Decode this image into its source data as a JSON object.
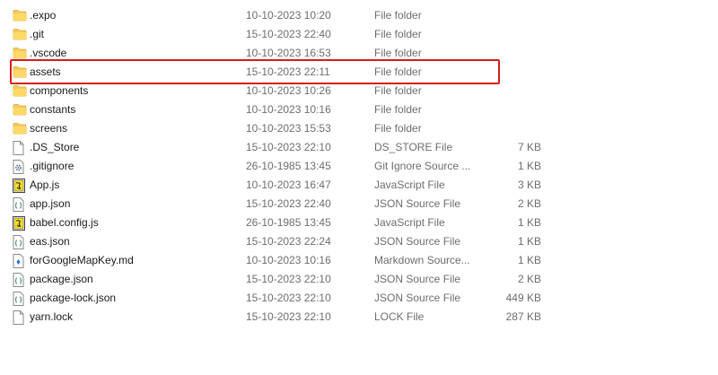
{
  "files": [
    {
      "name": ".expo",
      "date": "10-10-2023 10:20",
      "type": "File folder",
      "size": "",
      "icon": "folder-icon"
    },
    {
      "name": ".git",
      "date": "15-10-2023 22:40",
      "type": "File folder",
      "size": "",
      "icon": "folder-icon"
    },
    {
      "name": ".vscode",
      "date": "10-10-2023 16:53",
      "type": "File folder",
      "size": "",
      "icon": "folder-icon"
    },
    {
      "name": "assets",
      "date": "15-10-2023 22:11",
      "type": "File folder",
      "size": "",
      "icon": "folder-icon"
    },
    {
      "name": "components",
      "date": "10-10-2023 10:26",
      "type": "File folder",
      "size": "",
      "icon": "folder-icon"
    },
    {
      "name": "constants",
      "date": "10-10-2023 10:16",
      "type": "File folder",
      "size": "",
      "icon": "folder-icon"
    },
    {
      "name": "screens",
      "date": "10-10-2023 15:53",
      "type": "File folder",
      "size": "",
      "icon": "folder-icon"
    },
    {
      "name": ".DS_Store",
      "date": "15-10-2023 22:10",
      "type": "DS_STORE File",
      "size": "7 KB",
      "icon": "blank-file-icon"
    },
    {
      "name": ".gitignore",
      "date": "26-10-1985 13:45",
      "type": "Git Ignore Source ...",
      "size": "1 KB",
      "icon": "gear-file-icon"
    },
    {
      "name": "App.js",
      "date": "10-10-2023 16:47",
      "type": "JavaScript File",
      "size": "3 KB",
      "icon": "javascript-file-icon"
    },
    {
      "name": "app.json",
      "date": "15-10-2023 22:40",
      "type": "JSON Source File",
      "size": "2 KB",
      "icon": "json-file-icon"
    },
    {
      "name": "babel.config.js",
      "date": "26-10-1985 13:45",
      "type": "JavaScript File",
      "size": "1 KB",
      "icon": "javascript-file-icon"
    },
    {
      "name": "eas.json",
      "date": "15-10-2023 22:24",
      "type": "JSON Source File",
      "size": "1 KB",
      "icon": "json-file-icon"
    },
    {
      "name": "forGoogleMapKey.md",
      "date": "10-10-2023 10:16",
      "type": "Markdown Source...",
      "size": "1 KB",
      "icon": "markdown-file-icon"
    },
    {
      "name": "package.json",
      "date": "15-10-2023 22:10",
      "type": "JSON Source File",
      "size": "2 KB",
      "icon": "json-file-icon"
    },
    {
      "name": "package-lock.json",
      "date": "15-10-2023 22:10",
      "type": "JSON Source File",
      "size": "449 KB",
      "icon": "json-file-icon"
    },
    {
      "name": "yarn.lock",
      "date": "15-10-2023 22:10",
      "type": "LOCK File",
      "size": "287 KB",
      "icon": "blank-file-icon"
    }
  ],
  "highlight_color": "#d21e1e",
  "folder_color": "#f4c542"
}
